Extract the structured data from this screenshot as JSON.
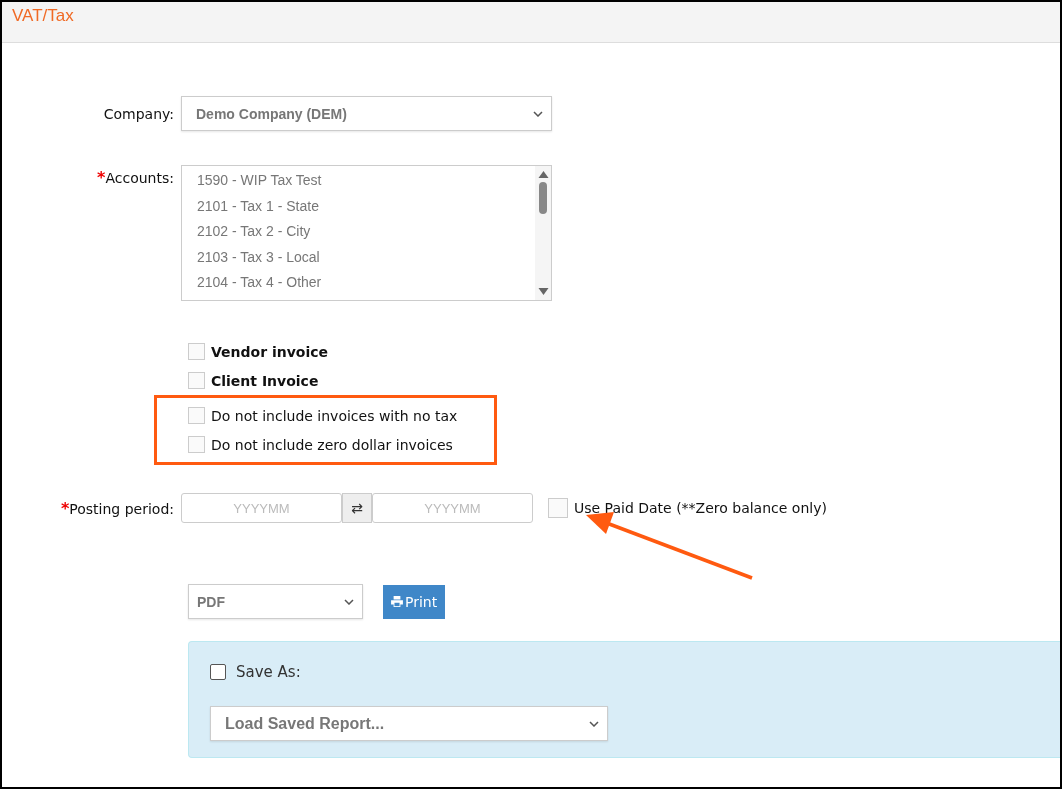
{
  "page": {
    "title": "VAT/Tax"
  },
  "company": {
    "label": "Company:",
    "value": "Demo Company (DEM)"
  },
  "accounts": {
    "required_mark": "*",
    "label": "Accounts:",
    "items": [
      {
        "label": "1590 - WIP Tax Test",
        "selected": false
      },
      {
        "label": "2101 - Tax 1 - State",
        "selected": false
      },
      {
        "label": "2102 - Tax 2 - City",
        "selected": false
      },
      {
        "label": "2103 - Tax 3 - Local",
        "selected": false
      },
      {
        "label": "2104 - Tax 4 - Other",
        "selected": false
      }
    ]
  },
  "options": [
    {
      "label": "Vendor invoice",
      "checked": false,
      "bold": true
    },
    {
      "label": "Client Invoice",
      "checked": false,
      "bold": true
    },
    {
      "label": "Do not include invoices with no tax",
      "checked": false,
      "bold": false
    },
    {
      "label": "Do not include zero dollar invoices",
      "checked": false,
      "bold": false
    }
  ],
  "posting_period": {
    "required_mark": "*",
    "label": "Posting period:",
    "from_placeholder": "YYYYMM",
    "swap_icon": "⇄",
    "to_placeholder": "YYYYMM",
    "paid_date": {
      "label": "Use Paid Date (**Zero balance only)",
      "checked": false
    }
  },
  "format": {
    "value": "PDF"
  },
  "print_button": {
    "label": "Print"
  },
  "saved_panel": {
    "save_as": {
      "label": "Save As:",
      "checked": false
    },
    "load_placeholder": "Load Saved Report..."
  }
}
